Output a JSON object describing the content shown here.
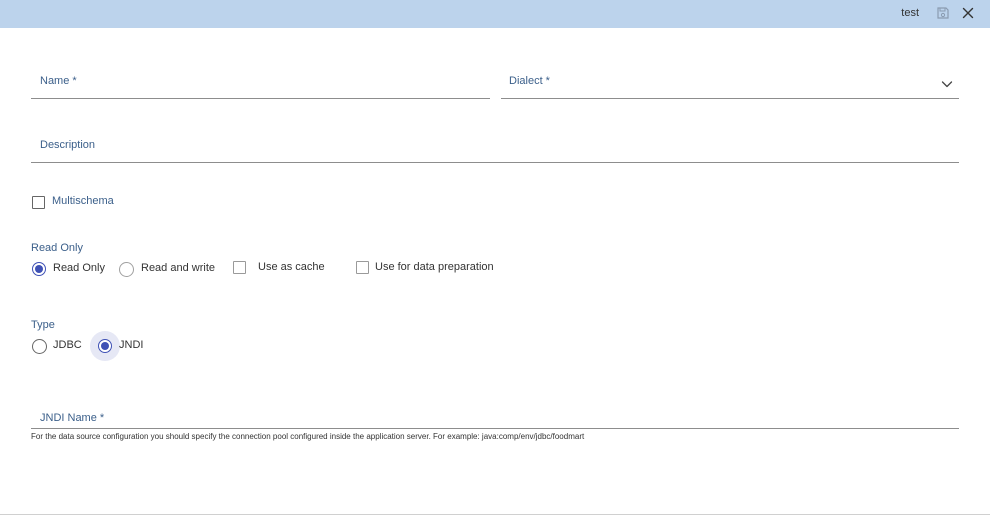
{
  "header": {
    "title": "test",
    "save_icon": "save-icon",
    "close_icon": "close-icon"
  },
  "form": {
    "name_label": "Name *",
    "name_value": "",
    "dialect_label": "Dialect *",
    "dialect_value": "",
    "description_label": "Description",
    "description_value": "",
    "multischema_label": "Multischema",
    "multischema_checked": false,
    "read_only_section_label": "Read Only",
    "access_options": [
      {
        "label": "Read Only",
        "selected": true
      },
      {
        "label": "Read and write",
        "selected": false
      }
    ],
    "use_as_cache_label": "Use as cache",
    "use_as_cache_checked": false,
    "use_for_data_prep_label": "Use for data preparation",
    "use_for_data_prep_checked": false,
    "type_section_label": "Type",
    "type_options": [
      {
        "label": "JDBC",
        "selected": false
      },
      {
        "label": "JNDI",
        "selected": true
      }
    ],
    "jndi_name_label": "JNDI Name *",
    "jndi_name_value": "",
    "jndi_hint": "For the data source configuration you should specify the connection pool configured inside the application server. For example: java:comp/env/jdbc/foodmart"
  },
  "colors": {
    "header_bg": "#bcd3ec",
    "accent": "#3f51b5",
    "label_blue": "#3b5f8a"
  }
}
